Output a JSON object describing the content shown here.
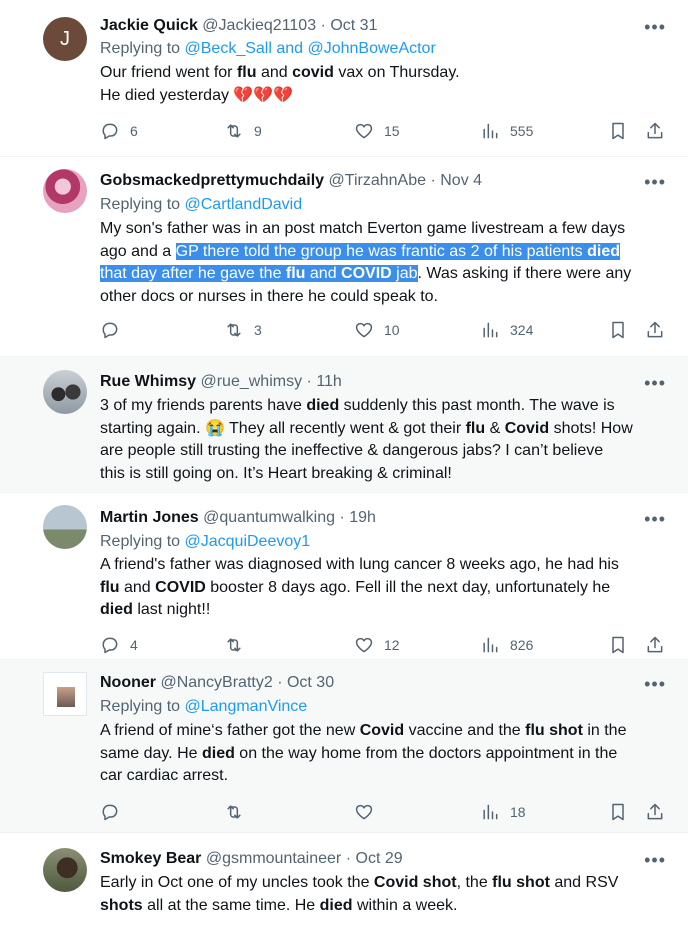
{
  "tweets": [
    {
      "name": "Jackie Quick",
      "handle": "@Jackieq21103",
      "time": "Oct 31",
      "replying_label": "Replying to",
      "replying_to": "@Beck_Sall and @JohnBoweActor",
      "lines": [
        [
          {
            "t": "Our friend went for "
          },
          {
            "t": "flu",
            "b": true
          },
          {
            "t": " and "
          },
          {
            "t": "covid",
            "b": true
          },
          {
            "t": " vax on Thursday."
          }
        ],
        [
          {
            "t": "He died yesterday "
          },
          {
            "t": "💔💔💔",
            "e": true
          }
        ]
      ],
      "replies": "6",
      "reposts": "9",
      "likes": "15",
      "views": "555",
      "avatar_letter": "J",
      "avatar_color": "#6b4a3a"
    },
    {
      "name": "Gobsmackedprettymuchdaily",
      "handle": "@TirzahnAbe",
      "time": "Nov 4",
      "replying_label": "Replying to",
      "replying_to": "@CartlandDavid",
      "lines": [
        [
          {
            "t": "My son's father was in an post match Everton game livestream a few days"
          }
        ],
        [
          {
            "t": "ago and a "
          },
          {
            "t": "GP there told the group he was frantic as 2 of his patients ",
            "h": true
          },
          {
            "t": "died",
            "b": true,
            "h": true
          }
        ],
        [
          {
            "t": "that day after he gave the ",
            "h": true
          },
          {
            "t": "flu",
            "b": true,
            "h": true
          },
          {
            "t": " and ",
            "h": true
          },
          {
            "t": "COVID",
            "b": true,
            "h": true
          },
          {
            "t": " jab",
            "h": true
          },
          {
            "t": ".  Was asking if there were any"
          }
        ],
        [
          {
            "t": "other docs or nurses in there he could speak to."
          }
        ]
      ],
      "replies": "",
      "reposts": "3",
      "likes": "10",
      "views": "324"
    },
    {
      "name": "Rue Whimsy",
      "handle": "@rue_whimsy",
      "time": "11h",
      "replying_label": "",
      "replying_to": "",
      "lines": [
        [
          {
            "t": "3 of my friends parents have "
          },
          {
            "t": "died",
            "b": true
          },
          {
            "t": " suddenly this past month. The wave is"
          }
        ],
        [
          {
            "t": "starting again. "
          },
          {
            "t": "😭",
            "e": true
          },
          {
            "t": "  They all recently went & got their "
          },
          {
            "t": "flu",
            "b": true
          },
          {
            "t": " & "
          },
          {
            "t": "Covid",
            "b": true
          },
          {
            "t": " shots! How"
          }
        ],
        [
          {
            "t": "are people still trusting the ineffective & dangerous jabs? I can’t believe"
          }
        ],
        [
          {
            "t": "this is still going on. It’s Heart breaking & criminal!"
          }
        ]
      ]
    },
    {
      "name": "Martin Jones",
      "handle": "@quantumwalking",
      "time": "19h",
      "replying_label": "Replying to",
      "replying_to": "@JacquiDeevoy1",
      "lines": [
        [
          {
            "t": "A friend's father was diagnosed with lung cancer 8 weeks ago, he had his"
          }
        ],
        [
          {
            "t": "flu",
            "b": true
          },
          {
            "t": " and "
          },
          {
            "t": "COVID",
            "b": true
          },
          {
            "t": " booster 8 days ago. Fell ill the next day, unfortunately he"
          }
        ],
        [
          {
            "t": "died",
            "b": true
          },
          {
            "t": " last night!!"
          }
        ]
      ],
      "replies": "4",
      "reposts": "",
      "likes": "12",
      "views": "826"
    },
    {
      "name": "Nooner",
      "handle": "@NancyBratty2",
      "time": "Oct 30",
      "replying_label": "Replying to",
      "replying_to": "@LangmanVince",
      "lines": [
        [
          {
            "t": "A friend of mine‘s father got the  new "
          },
          {
            "t": "Covid",
            "b": true
          },
          {
            "t": " vaccine and the "
          },
          {
            "t": "flu shot",
            "b": true
          },
          {
            "t": " in the"
          }
        ],
        [
          {
            "t": "same day. He "
          },
          {
            "t": "died",
            "b": true
          },
          {
            "t": " on the way home from the doctors appointment in the"
          }
        ],
        [
          {
            "t": "car cardiac arrest."
          }
        ]
      ],
      "replies": "",
      "reposts": "",
      "likes": "",
      "views": "18"
    },
    {
      "name": "Smokey Bear",
      "handle": "@gsmmountaineer",
      "time": "Oct 29",
      "replying_label": "",
      "replying_to": "",
      "lines": [
        [
          {
            "t": "Early in Oct one of my uncles took the "
          },
          {
            "t": "Covid shot",
            "b": true
          },
          {
            "t": ", the "
          },
          {
            "t": "flu shot",
            "b": true
          },
          {
            "t": " and RSV"
          }
        ],
        [
          {
            "t": "shots",
            "b": true
          },
          {
            "t": " all at the same time.    He "
          },
          {
            "t": "died",
            "b": true
          },
          {
            "t": " within a week."
          }
        ]
      ]
    }
  ],
  "colors": {
    "link": "#1d9bf0",
    "muted": "#536471",
    "highlight": "#3b8eea",
    "text": "#0f1419"
  },
  "icons": {
    "more": "more-dots-icon",
    "reply": "reply-icon",
    "repost": "repost-icon",
    "like": "heart-icon",
    "views": "views-icon",
    "bookmark": "bookmark-icon",
    "share": "share-icon"
  }
}
